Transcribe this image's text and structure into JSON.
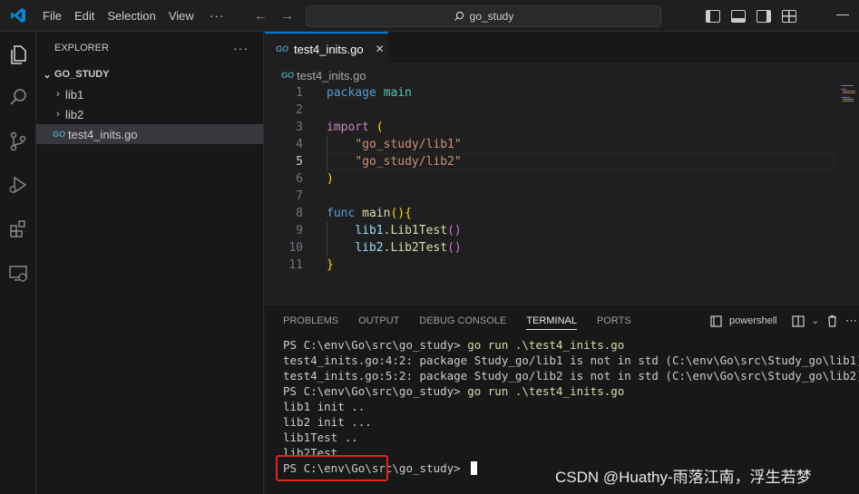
{
  "titlebar": {
    "menu": [
      "File",
      "Edit",
      "Selection",
      "View"
    ],
    "menu_more": "···",
    "search": "go_study"
  },
  "sidebar": {
    "header": "EXPLORER",
    "more": "···",
    "root": "GO_STUDY",
    "items": [
      {
        "label": "lib1",
        "type": "folder"
      },
      {
        "label": "lib2",
        "type": "folder"
      },
      {
        "label": "test4_inits.go",
        "type": "file",
        "selected": true
      }
    ],
    "file_badge": "GO"
  },
  "editor": {
    "tab_label": "test4_inits.go",
    "tab_close": "✕",
    "breadcrumb": "test4_inits.go",
    "active_line": 5,
    "line_numbers": [
      "1",
      "2",
      "3",
      "4",
      "5",
      "6",
      "7",
      "8",
      "9",
      "10",
      "11"
    ]
  },
  "panel": {
    "tabs": [
      "PROBLEMS",
      "OUTPUT",
      "DEBUG CONSOLE",
      "TERMINAL",
      "PORTS"
    ],
    "active_tab": "TERMINAL",
    "shell": "powershell",
    "terminal_lines": [
      {
        "prompt": "PS C:\\env\\Go\\src\\go_study> ",
        "cmd": "go run .\\test4_inits.go"
      },
      {
        "text": "test4_inits.go:4:2: package Study_go/lib1 is not in std (C:\\env\\Go\\src\\Study_go\\lib1)"
      },
      {
        "text": "test4_inits.go:5:2: package Study_go/lib2 is not in std (C:\\env\\Go\\src\\Study_go\\lib2)"
      },
      {
        "prompt": "PS C:\\env\\Go\\src\\go_study> ",
        "cmd": "go run .\\test4_inits.go"
      },
      {
        "text": "lib1 init .."
      },
      {
        "text": "lib2 init ..."
      },
      {
        "text": "lib1Test .."
      },
      {
        "text": "lib2Test .."
      },
      {
        "prompt": "PS C:\\env\\Go\\src\\go_study> ",
        "cmd": ""
      }
    ]
  },
  "watermark": "CSDN @Huathy-雨落江南，浮生若梦",
  "colors": {
    "accent": "#0078d4",
    "highlight_box": "#e0251f"
  }
}
